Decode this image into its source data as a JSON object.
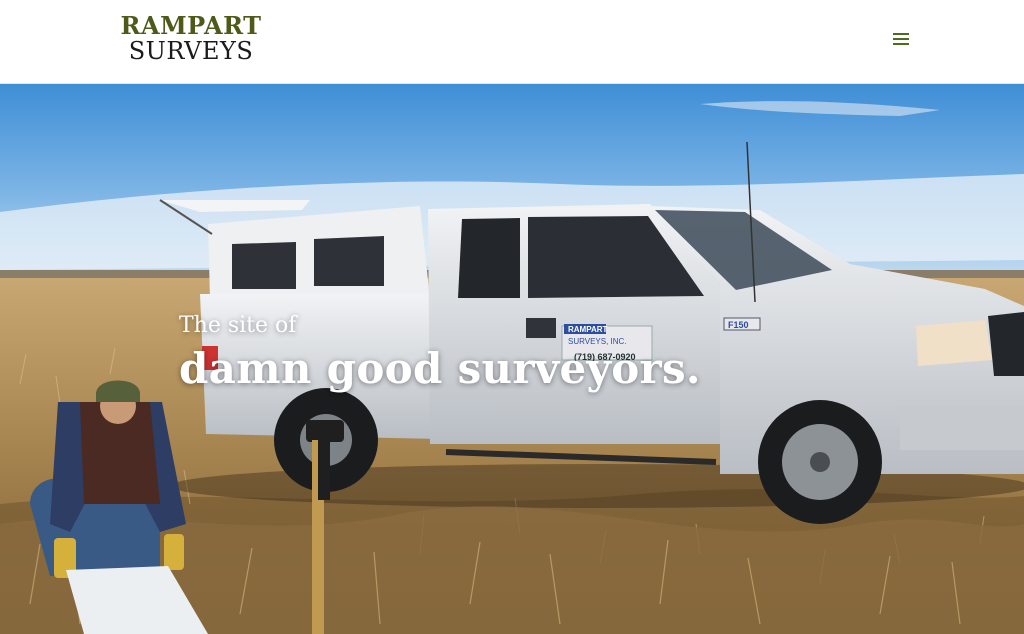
{
  "header": {
    "logo_line1": "RAMPART",
    "logo_line2": "SURVEYS",
    "menu_icon": "hamburger-menu-icon",
    "logo_color": "#4e5a1a",
    "menu_color": "#4e6c1f"
  },
  "hero": {
    "line_small": "The site of",
    "line_large": "damn good surveyors.",
    "truck_door_sign": {
      "company": "RAMPART",
      "name_line": "SURVEYS, INC.",
      "phone": "(719) 687-0920"
    },
    "truck_badge": "F150"
  }
}
